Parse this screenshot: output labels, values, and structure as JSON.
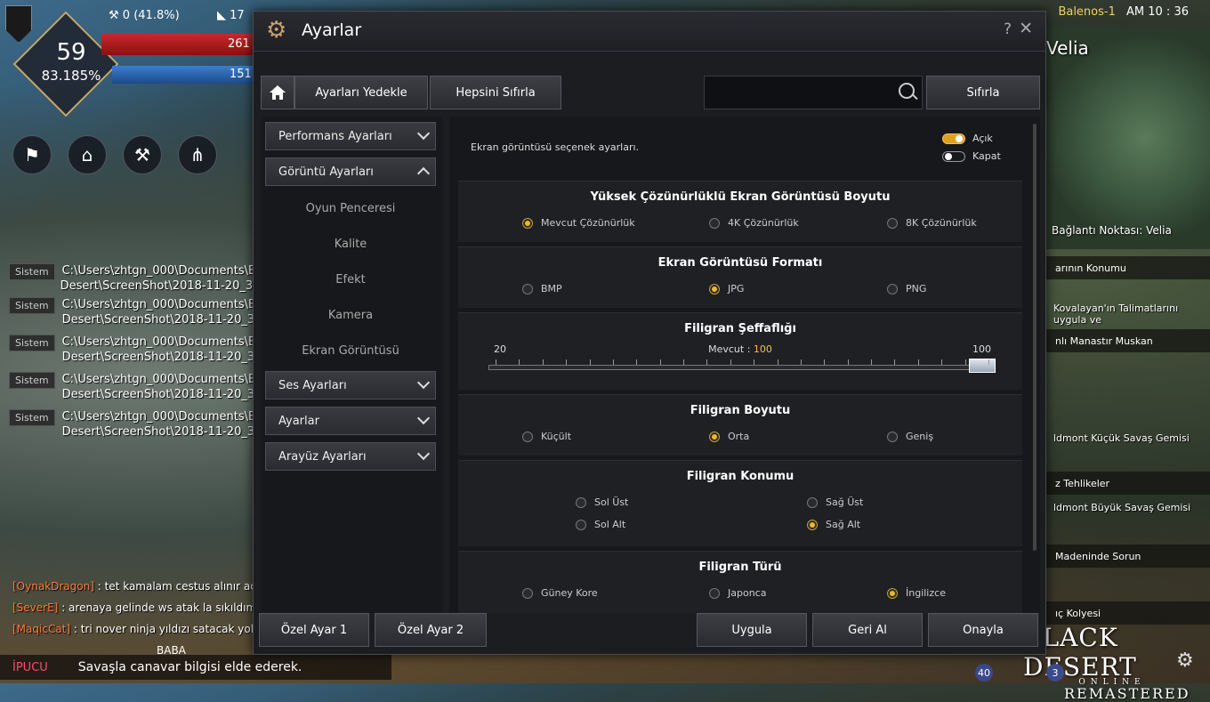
{
  "hud": {
    "level": "59",
    "level_pct": "83.185%",
    "stat_energy": "0 (41.8%)",
    "stat_weight": "17",
    "hp_value": "261",
    "mp_value": "151",
    "server": "Balenos-1",
    "time": "AM 10 : 36",
    "region": "Velia",
    "connection_point": "Bağlantı Noktası: Velia",
    "system_tag": "Sistem",
    "system_messages": [
      {
        "line1": "C:\\Users\\zhtgn_000\\Documents\\B",
        "line2": "Desert\\ScreenShot\\2018-11-20_3"
      },
      {
        "line1": "C:\\Users\\zhtgn_000\\Documents\\B",
        "line2": "Desert\\ScreenShot\\2018-11-20_3"
      },
      {
        "line1": "C:\\Users\\zhtgn_000\\Documents\\B",
        "line2": "Desert\\ScreenShot\\2018-11-20_3"
      },
      {
        "line1": "C:\\Users\\zhtgn_000\\Documents\\B",
        "line2": "Desert\\ScreenShot\\2018-11-20_3"
      },
      {
        "line1": "C:\\Users\\zhtgn_000\\Documents\\B",
        "line2": "Desert\\ScreenShot\\2018-11-20_3"
      }
    ],
    "chat": [
      {
        "name": "[OynakDragon]",
        "msg": " : tet kamalam cestus alınır ac"
      },
      {
        "name": "[SeverE]",
        "msg": " : arenaya gelinde ws atak la sıkıldım"
      },
      {
        "name": "[MaqicCat]",
        "msg": " : tri nover ninja yıldızı satacak yok"
      }
    ],
    "tip_label": "İPUCU",
    "tip_text": "Savaşla canavar bilgisi elde ederek.",
    "baba": "BABA",
    "quests": [
      {
        "text": "arının Konumu"
      },
      {
        "text": "nlı Manastır Muskan"
      },
      {
        "text": "z Tehlikeler"
      },
      {
        "text": "Madeninde Sorun"
      },
      {
        "text": "ıç Kolyesi"
      }
    ],
    "quest_subs": [
      {
        "text": "Kovalayan'ın Talimatlarını uygula ve"
      },
      {
        "text": "ldmont Küçük Savaş Gemisi"
      },
      {
        "text": "ldmont Büyük Savaş Gemisi"
      }
    ],
    "logo_main": "BLACK DESERT",
    "logo_sub": "ONLINE",
    "logo_remaster": "REMASTERED",
    "badge1": "40",
    "badge2": "3"
  },
  "window": {
    "title": "Ayarlar",
    "help": "?",
    "close": "✕"
  },
  "toolbar": {
    "backup": "Ayarları Yedekle",
    "reset_all": "Hepsini Sıfırla",
    "search_placeholder": "",
    "reset": "Sıfırla"
  },
  "sidebar": {
    "performance": "Performans Ayarları",
    "display": "Görüntü Ayarları",
    "display_items": [
      "Oyun Penceresi",
      "Kalite",
      "Efekt",
      "Kamera",
      "Ekran Görüntüsü"
    ],
    "sound": "Ses Ayarları",
    "settings": "Ayarlar",
    "interface": "Arayüz Ayarları"
  },
  "content": {
    "description": "Ekran görüntüsü seçenek ayarları.",
    "legend_on": "Açık",
    "legend_off": "Kapat",
    "resolution": {
      "title": "Yüksek Çözünürlüklü Ekran Görüntüsü Boyutu",
      "options": [
        "Mevcut Çözünürlük",
        "4K Çözünürlük",
        "8K Çözünürlük"
      ],
      "selected": 0
    },
    "format": {
      "title": "Ekran Görüntüsü Formatı",
      "options": [
        "BMP",
        "JPG",
        "PNG"
      ],
      "selected": 1
    },
    "opacity": {
      "title": "Filigran Şeffaflığı",
      "min": "20",
      "max": "100",
      "current_label": "Mevcut : ",
      "current": "100",
      "value": 100,
      "range": [
        20,
        100
      ]
    },
    "wm_size": {
      "title": "Filigran Boyutu",
      "options": [
        "Küçült",
        "Orta",
        "Geniş"
      ],
      "selected": 1
    },
    "wm_position": {
      "title": "Filigran Konumu",
      "options": [
        "Sol Üst",
        "Sağ Üst",
        "Sol Alt",
        "Sağ Alt"
      ],
      "selected": 3
    },
    "wm_type": {
      "title": "Filigran Türü",
      "options": [
        "Güney Kore",
        "Japonca",
        "İngilizce"
      ],
      "selected": 2
    }
  },
  "footer": {
    "preset1": "Özel Ayar 1",
    "preset2": "Özel Ayar 2",
    "apply": "Uygula",
    "revert": "Geri Al",
    "confirm": "Onayla"
  }
}
